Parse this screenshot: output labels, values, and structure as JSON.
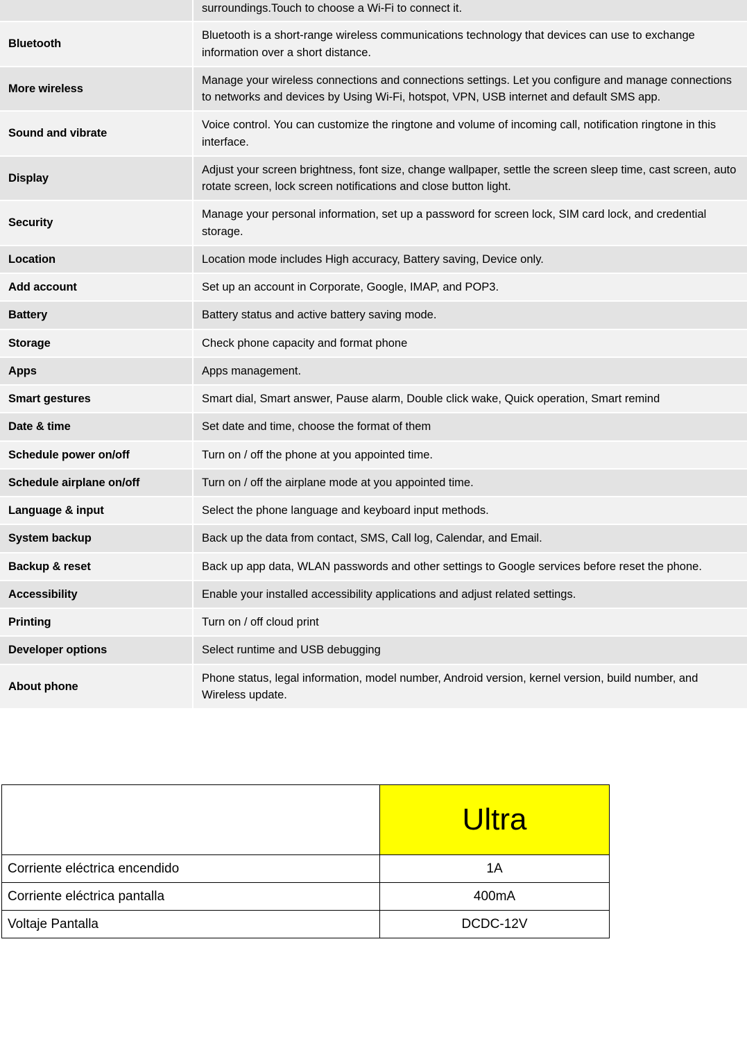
{
  "settings_table": {
    "rows": [
      {
        "name": "",
        "desc": "surroundings.Touch to choose a Wi-Fi to connect it.",
        "shade": "dark",
        "partial": true
      },
      {
        "name": "Bluetooth",
        "desc": "Bluetooth is a short-range wireless communications technology that devices can use to exchange information over a short distance.",
        "shade": "light"
      },
      {
        "name": "More wireless",
        "desc": "Manage your wireless connections and connections settings. Let you configure and manage connections to networks and devices by Using Wi-Fi, hotspot, VPN, USB internet and default SMS app.",
        "shade": "dark"
      },
      {
        "name": "Sound and vibrate",
        "desc": "Voice control. You can customize the ringtone and volume of incoming call, notification ringtone in this interface.",
        "shade": "light"
      },
      {
        "name": "Display",
        "desc": "Adjust your screen brightness, font size, change wallpaper, settle the screen sleep time, cast screen, auto rotate screen, lock screen notifications and close button light.",
        "shade": "dark"
      },
      {
        "name": "Security",
        "desc": "Manage your personal information, set up a password for screen lock, SIM card lock, and credential storage.",
        "shade": "light"
      },
      {
        "name": "Location",
        "desc": "Location mode includes High accuracy, Battery saving, Device only.",
        "shade": "dark"
      },
      {
        "name": "Add account",
        "desc": "Set up an account in Corporate, Google, IMAP, and POP3.",
        "shade": "light"
      },
      {
        "name": "Battery",
        "desc": "Battery status and active battery saving mode.",
        "shade": "dark"
      },
      {
        "name": "Storage",
        "desc": "Check phone capacity and format phone",
        "shade": "light"
      },
      {
        "name": "Apps",
        "desc": "Apps management.",
        "shade": "dark"
      },
      {
        "name": "Smart gestures",
        "desc": "Smart dial, Smart answer, Pause alarm, Double click wake, Quick operation, Smart remind",
        "shade": "light"
      },
      {
        "name": "Date & time",
        "desc": "Set date and time, choose the format of them",
        "shade": "dark"
      },
      {
        "name": "Schedule power on/off",
        "desc": "Turn on / off the phone at you appointed time.",
        "shade": "light"
      },
      {
        "name": "Schedule airplane on/off",
        "desc": "Turn on / off the airplane mode at you appointed time.",
        "shade": "dark"
      },
      {
        "name": "Language & input",
        "desc": "Select the phone language and keyboard input methods.",
        "shade": "light"
      },
      {
        "name": "System backup",
        "desc": "Back up the data from contact, SMS, Call log, Calendar, and Email.",
        "shade": "dark"
      },
      {
        "name": "Backup & reset",
        "desc": "Back up app data, WLAN passwords and other settings to Google services before reset the phone.",
        "shade": "light"
      },
      {
        "name": "Accessibility",
        "desc": "Enable your installed accessibility applications and adjust related settings.",
        "shade": "dark"
      },
      {
        "name": "Printing",
        "desc": "Turn on / off cloud print",
        "shade": "light"
      },
      {
        "name": "Developer options",
        "desc": "Select runtime and USB debugging",
        "shade": "dark"
      },
      {
        "name": "About phone",
        "desc": "Phone status, legal information, model number, Android version, kernel version, build number, and Wireless update.",
        "shade": "light"
      }
    ]
  },
  "spec_table": {
    "header": {
      "blank_label": "",
      "brand_label": "Ultra",
      "brand_bg_color": "#ffff00"
    },
    "rows": [
      {
        "label": "Corriente eléctrica encendido",
        "value": "1A"
      },
      {
        "label": "Corriente eléctrica pantalla",
        "value": "400mA"
      },
      {
        "label": "Voltaje Pantalla",
        "value": "DCDC-12V"
      }
    ]
  }
}
